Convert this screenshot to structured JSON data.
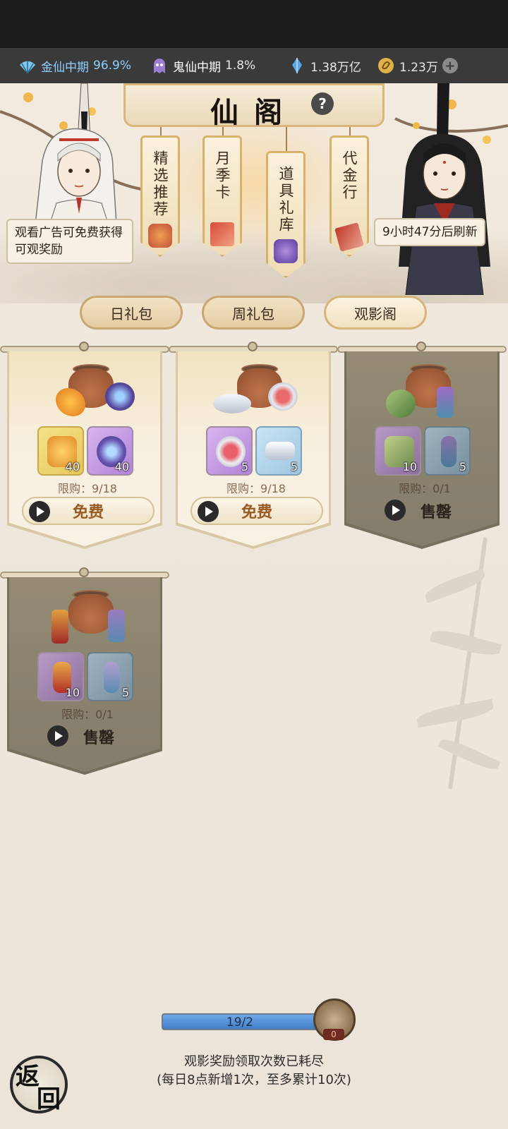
{
  "resources": {
    "realm1": {
      "label": "金仙中期",
      "value": "96.9%"
    },
    "realm2": {
      "label": "鬼仙中期",
      "value": "1.8%"
    },
    "gems": "1.38万亿",
    "coins": "1.23万"
  },
  "header": {
    "title": "仙阁",
    "help": "?"
  },
  "hang_tabs": [
    {
      "label": "精选推荐"
    },
    {
      "label": "月季卡"
    },
    {
      "label": "道具礼库"
    },
    {
      "label": "代金行"
    }
  ],
  "npc_left_speech": "观看广告可免费获得可观奖励",
  "npc_right_speech": "9小时47分后刷新",
  "sub_tabs": [
    {
      "label": "日礼包"
    },
    {
      "label": "周礼包"
    },
    {
      "label": "观影阁",
      "active": true
    }
  ],
  "packs": [
    {
      "items": [
        {
          "icon": "gold-leaf-icon",
          "count": "40"
        },
        {
          "icon": "jade-ring-icon",
          "count": "40"
        }
      ],
      "limit": "限购：9/18",
      "action": "免费",
      "sold_out": false
    },
    {
      "items": [
        {
          "icon": "mirror-icon",
          "count": "5"
        },
        {
          "icon": "silver-ingot-icon",
          "count": "5"
        }
      ],
      "limit": "限购：9/18",
      "action": "免费",
      "sold_out": false
    },
    {
      "items": [
        {
          "icon": "jade-pendant-icon",
          "count": "10"
        },
        {
          "icon": "tassel-charm-icon",
          "count": "5"
        }
      ],
      "limit": "限购：0/1",
      "action": "售罄",
      "sold_out": true
    },
    {
      "items": [
        {
          "icon": "lantern-charm-icon",
          "count": "10"
        },
        {
          "icon": "blue-charm-icon",
          "count": "5"
        }
      ],
      "limit": "限购：0/1",
      "action": "售罄",
      "sold_out": true
    }
  ],
  "progress": {
    "text": "19/2",
    "fill": 1.0,
    "badge": "0"
  },
  "bottom": {
    "line1": "观影奖励领取次数已耗尽",
    "line2": "(每日8点新增1次，至多累计10次)"
  },
  "back": {
    "c1": "返",
    "c2": "回"
  },
  "colors": {
    "accent": "#d8b26a",
    "free_text": "#9a5a23",
    "progress": "#3f7fc8"
  }
}
